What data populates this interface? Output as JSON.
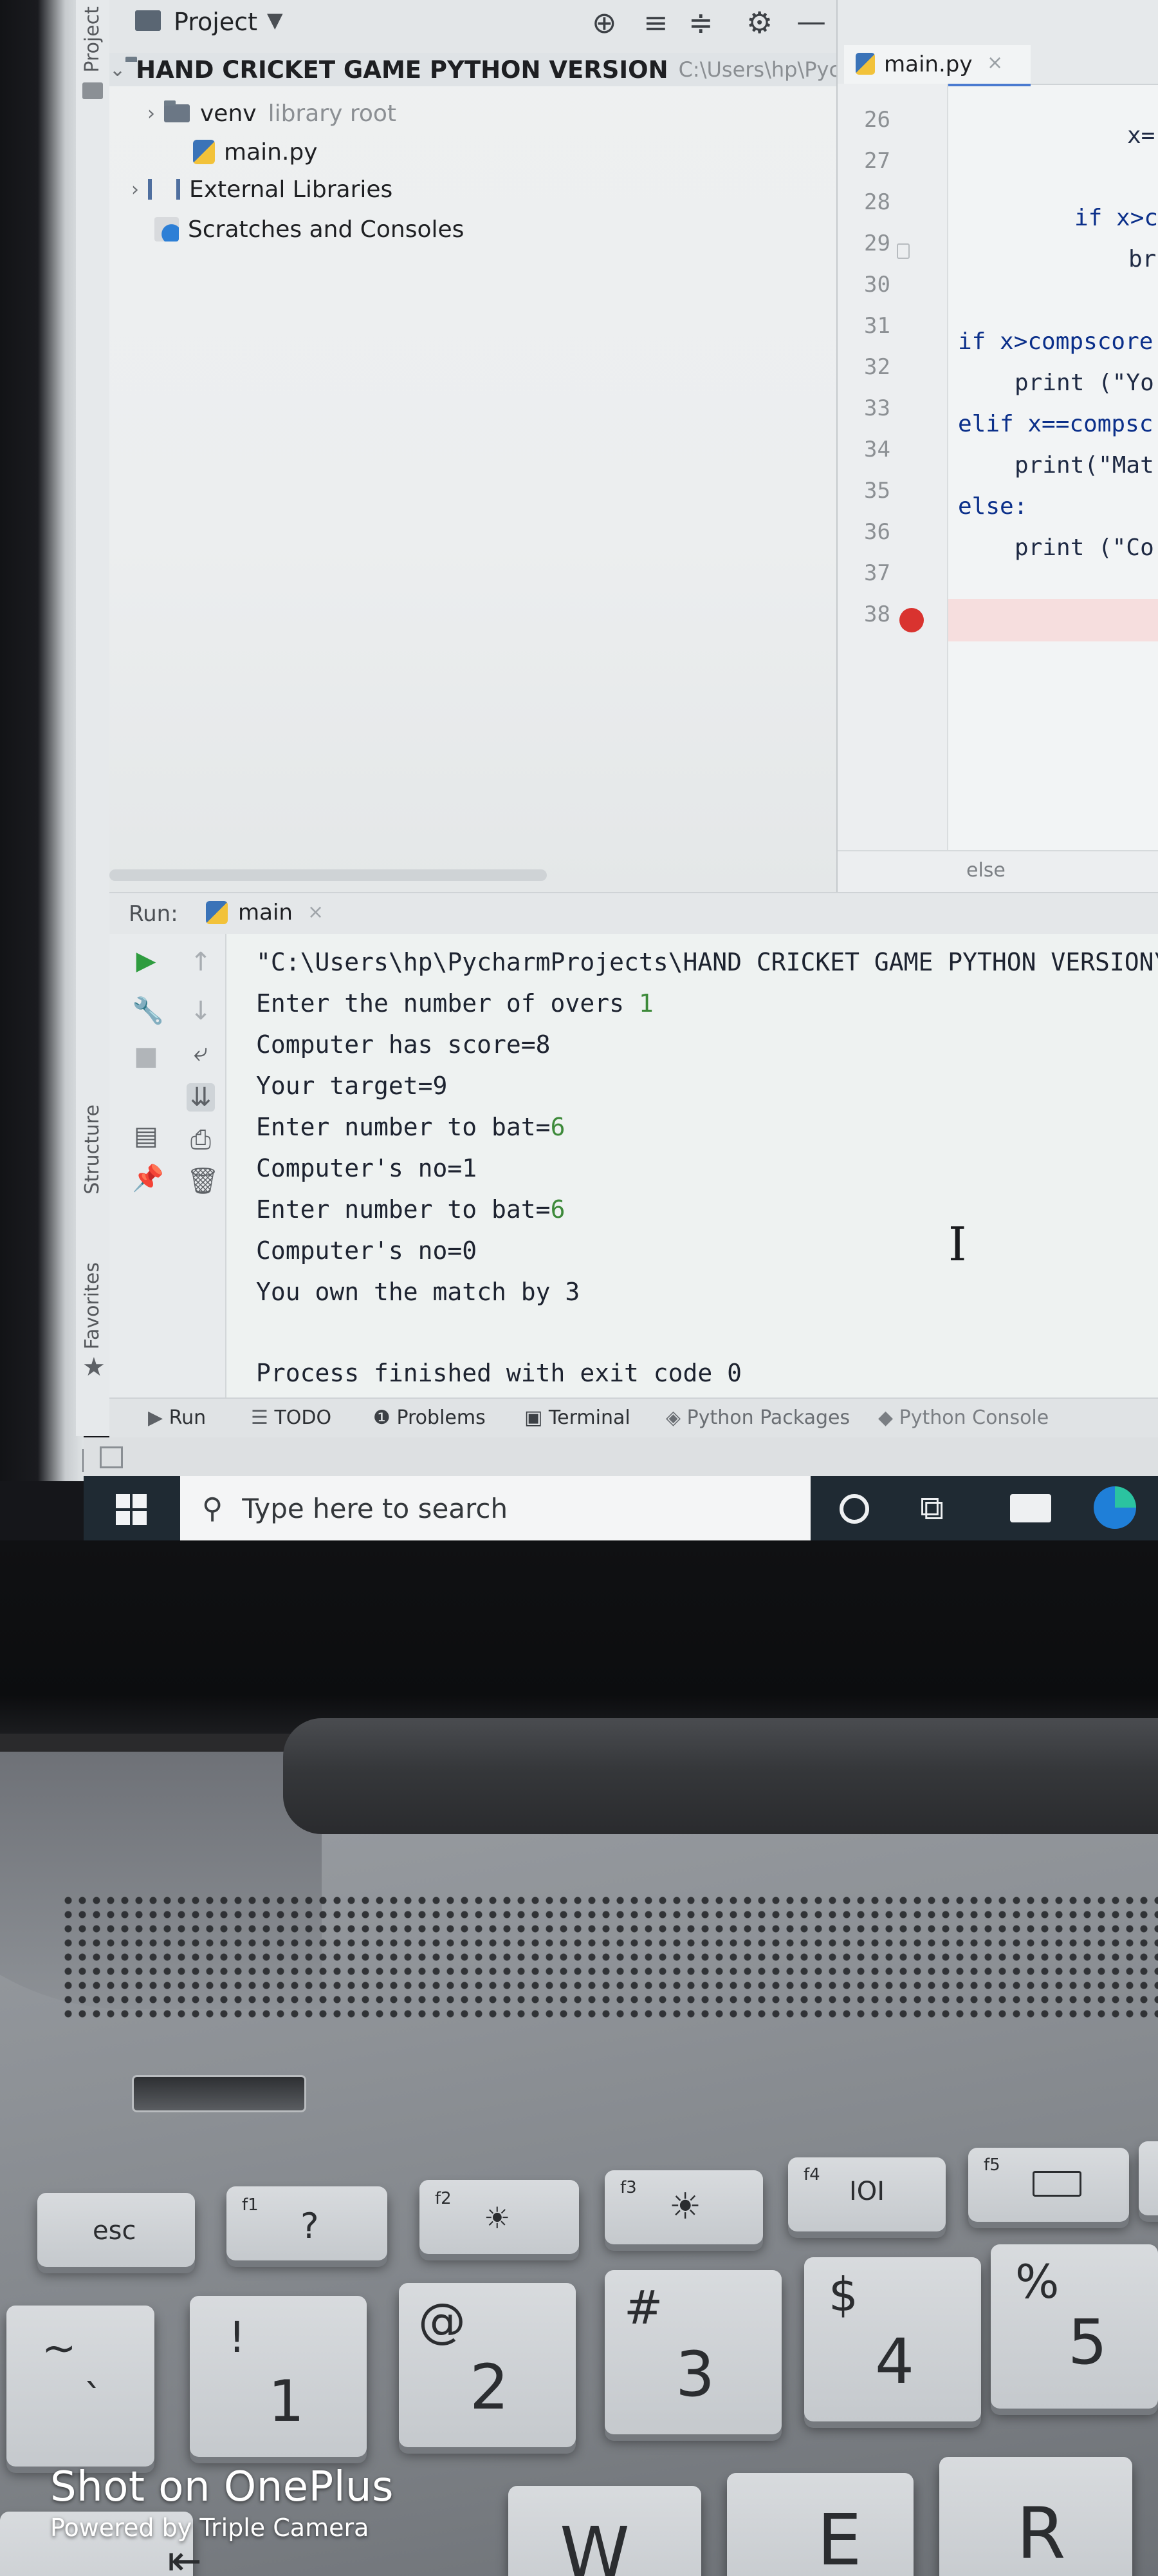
{
  "project_panel": {
    "header_label": "Project",
    "root_name": "HAND CRICKET GAME PYTHON VERSION",
    "root_path": "C:\\Users\\hp\\Pycharm",
    "venv": "venv",
    "venv_note": "library root",
    "main_file": "main.py",
    "external_libraries": "External Libraries",
    "scratches": "Scratches and Consoles",
    "side_tab_project": "Project",
    "side_tab_structure": "Structure",
    "side_tab_favorites": "Favorites"
  },
  "editor": {
    "tab_label": "main.py",
    "line_numbers": [
      "26",
      "27",
      "28",
      "29",
      "30",
      "31",
      "32",
      "33",
      "34",
      "35",
      "36",
      "37",
      "38"
    ],
    "lines": {
      "l26": "x=",
      "l28": "if x>c",
      "l29": "br",
      "l31": "if x>compscore",
      "l32": "print (\"Yo",
      "l33": "elif x==compsc",
      "l34": "print(\"Mat",
      "l35": "else:",
      "l36": "print (\"Co"
    },
    "breadcrumb": "else"
  },
  "run": {
    "label": "Run:",
    "tab": "main",
    "console": {
      "line1": "\"C:\\Users\\hp\\PycharmProjects\\HAND CRICKET GAME PYTHON VERSION\\",
      "line2_prefix": "Enter the number of overs ",
      "line2_input": "1",
      "line3": "Computer has score=8",
      "line4": "Your target=9",
      "line5_prefix": "Enter number to bat=",
      "line5_input": "6",
      "line6": "Computer's no=1",
      "line7_prefix": "Enter number to bat=",
      "line7_input": "6",
      "line8": "Computer's no=0",
      "line9": "You own the match by 3",
      "line10": "Process finished with exit code 0"
    }
  },
  "bottom_tabs": {
    "run": "Run",
    "todo": "TODO",
    "problems": "Problems",
    "terminal": "Terminal",
    "python_packages": "Python Packages",
    "python_console": "Python Console"
  },
  "taskbar": {
    "search_placeholder": "Type here to search"
  },
  "keyboard": {
    "esc": "esc",
    "f1": "f1",
    "f1_symbol": "?",
    "f2": "f2",
    "f2_symbol": "☀",
    "f3": "f3",
    "f3_symbol": "☀",
    "f4": "f4",
    "f4_symbol": "IOI",
    "f5": "f5",
    "tilde": "~",
    "backtick": "`",
    "k1_top": "!",
    "k1": "1",
    "k2_top": "@",
    "k2": "2",
    "k3_top": "#",
    "k3": "3",
    "k4_top": "$",
    "k4": "4",
    "k5_top": "%",
    "k5": "5",
    "w": "W",
    "e": "E",
    "r": "R"
  },
  "watermark": {
    "main": "Shot on OnePlus",
    "sub": "Powered by Triple Camera"
  },
  "colors": {
    "run_green": "#2e9c3f",
    "breakpoint_red": "#d9332f",
    "edge_blue": "#1f7fd8"
  }
}
